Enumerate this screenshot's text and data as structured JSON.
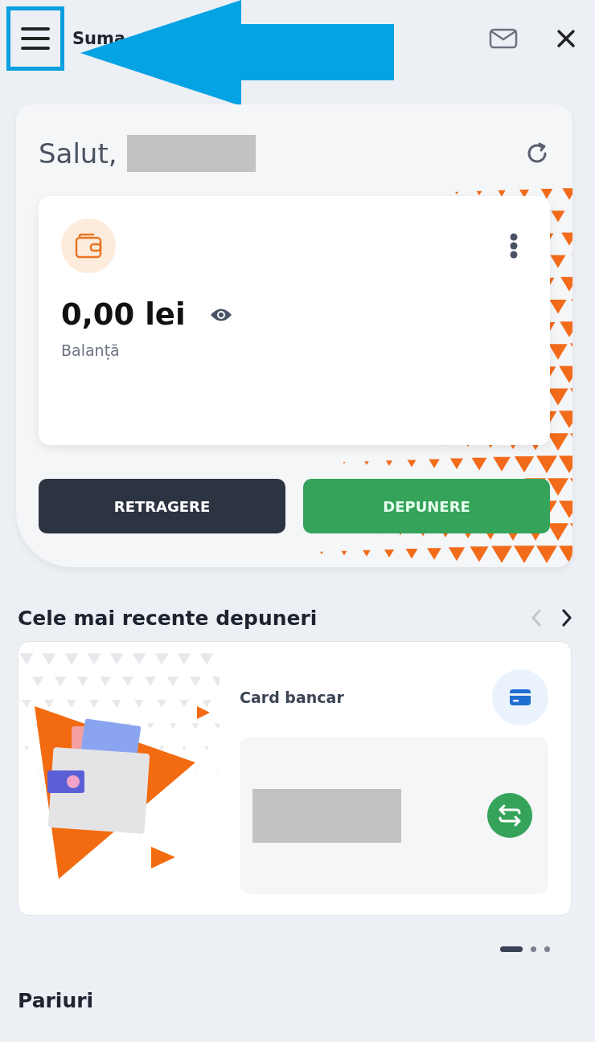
{
  "header": {
    "title": "Suma"
  },
  "greeting": {
    "text": "Salut,"
  },
  "balance": {
    "amount": "0,00 lei",
    "label": "Balanță"
  },
  "actions": [
    {
      "label": "RETRAGERE",
      "kind": "secondary"
    },
    {
      "label": "DEPUNERE",
      "kind": "primary"
    }
  ],
  "recent": {
    "title": "Cele mai recente depuneri",
    "nav": [
      {
        "kind": "prev",
        "disabled": true
      },
      {
        "kind": "next",
        "disabled": false
      }
    ]
  },
  "cards": [
    {
      "method": "Card bancar"
    }
  ],
  "pages": [
    {
      "selected": true
    },
    {
      "selected": false
    },
    {
      "selected": false
    }
  ],
  "next_section": {
    "title": "Pariuri"
  }
}
